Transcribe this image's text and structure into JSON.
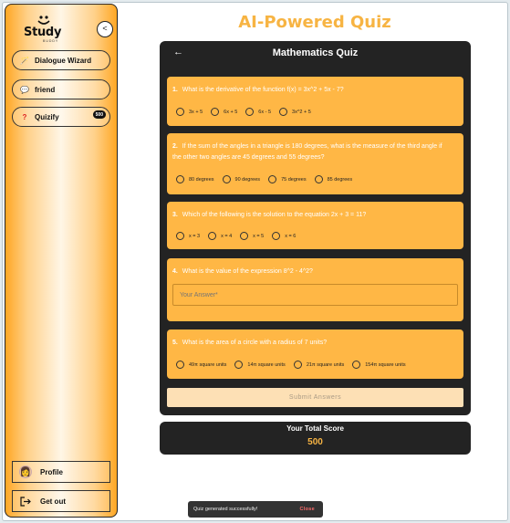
{
  "sidebar": {
    "logo_text": "Study",
    "logo_sub": "BUDDY",
    "collapse_symbol": "<",
    "items": [
      {
        "label": "Dialogue Wizard",
        "icon": "magic-wand-icon"
      },
      {
        "label": "friend",
        "icon": "chat-bubble-icon"
      },
      {
        "label": "Quizify",
        "icon": "question-icon",
        "badge": "500"
      }
    ],
    "profile_label": "Profile",
    "logout_label": "Get out"
  },
  "main": {
    "title": "AI-Powered Quiz",
    "quiz_title": "Mathematics Quiz",
    "back_symbol": "←",
    "questions": [
      {
        "num": "1.",
        "text": "What is the derivative of the function f(x) = 3x^2 + 5x - 7?",
        "options": [
          "3x + 5",
          "6x + 5",
          "6x - 5",
          "3x^2 + 5"
        ]
      },
      {
        "num": "2.",
        "text": "If the sum of the angles in a triangle is 180 degrees, what is the measure of the third angle if the other two angles are 45 degrees and 55 degrees?",
        "options": [
          "80 degrees",
          "90 degrees",
          "75 degrees",
          "85 degrees"
        ]
      },
      {
        "num": "3.",
        "text": "Which of the following is the solution to the equation 2x + 3 = 11?",
        "options": [
          "x = 3",
          "x = 4",
          "x = 5",
          "x = 6"
        ]
      },
      {
        "num": "4.",
        "text": "What is the value of the expression 8^2 - 4^2?",
        "placeholder": "Your Answer*"
      },
      {
        "num": "5.",
        "text": "What is the area of a circle with a radius of 7 units?",
        "options": [
          "49π square units",
          "14π square units",
          "21π square units",
          "154π square units"
        ]
      }
    ],
    "submit_label": "Submit Answers",
    "score_label": "Your Total Score",
    "score_value": "500"
  },
  "toast": {
    "message": "Quiz generated successfully!",
    "close_label": "Close"
  },
  "colors": {
    "accent": "#f7b443",
    "card": "#ffb745",
    "panel": "#232323"
  }
}
